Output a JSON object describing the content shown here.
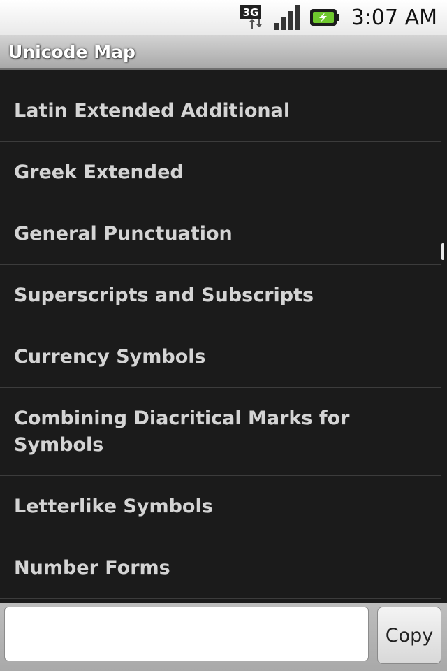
{
  "status_bar": {
    "network_label": "3G",
    "time": "3:07 AM",
    "colors": {
      "battery": "#6fc92e"
    }
  },
  "app": {
    "title": "Unicode Map"
  },
  "list": {
    "items": [
      {
        "label": "Latin Extended Additional"
      },
      {
        "label": "Greek Extended"
      },
      {
        "label": "General Punctuation"
      },
      {
        "label": "Superscripts and Subscripts"
      },
      {
        "label": "Currency Symbols"
      },
      {
        "label": "Combining Diacritical Marks for Symbols"
      },
      {
        "label": "Letterlike Symbols"
      },
      {
        "label": "Number Forms"
      }
    ]
  },
  "bottom_bar": {
    "input_value": "",
    "copy_label": "Copy"
  }
}
